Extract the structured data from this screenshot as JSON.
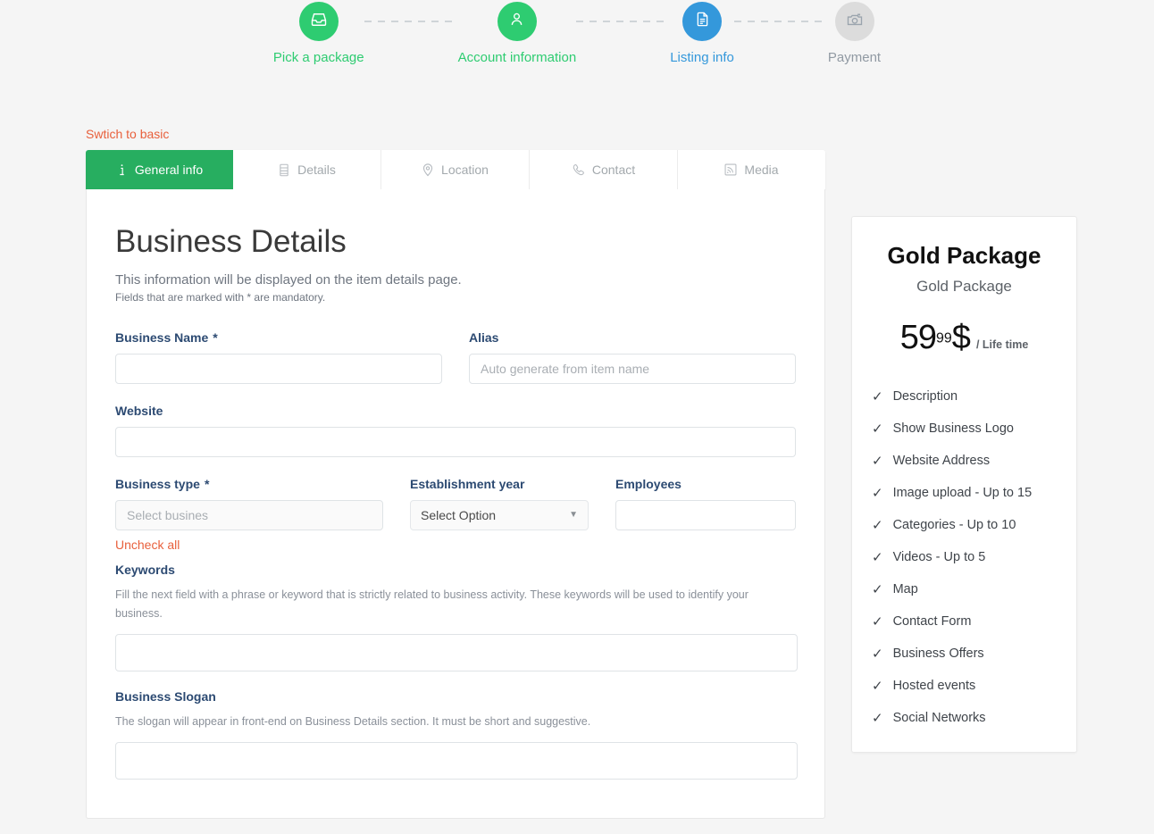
{
  "stepper": {
    "steps": [
      {
        "label": "Pick a package",
        "icon": "inbox-icon",
        "state": "green"
      },
      {
        "label": "Account information",
        "icon": "user-icon",
        "state": "green"
      },
      {
        "label": "Listing info",
        "icon": "document-icon",
        "state": "blue"
      },
      {
        "label": "Payment",
        "icon": "camera-icon",
        "state": "gray"
      }
    ]
  },
  "switch_link": "Swtich to basic",
  "tabs": [
    {
      "label": "General info",
      "icon": "info-icon",
      "active": true
    },
    {
      "label": "Details",
      "icon": "list-icon",
      "active": false
    },
    {
      "label": "Location",
      "icon": "map-pin-icon",
      "active": false
    },
    {
      "label": "Contact",
      "icon": "phone-icon",
      "active": false
    },
    {
      "label": "Media",
      "icon": "rss-icon",
      "active": false
    }
  ],
  "form": {
    "title": "Business Details",
    "subtitle": "This information will be displayed on the item details page.",
    "note": "Fields that are marked with * are mandatory.",
    "business_name": {
      "label": "Business Name",
      "required": "*",
      "value": "",
      "placeholder": ""
    },
    "alias": {
      "label": "Alias",
      "value": "",
      "placeholder": "Auto generate from item name"
    },
    "website": {
      "label": "Website",
      "value": "",
      "placeholder": ""
    },
    "business_type": {
      "label": "Business type",
      "required": "*",
      "value": "",
      "placeholder": "Select busines",
      "uncheck_label": "Uncheck all"
    },
    "establishment_year": {
      "label": "Establishment year",
      "selected": "Select Option",
      "caret": "▼"
    },
    "employees": {
      "label": "Employees",
      "value": "",
      "placeholder": ""
    },
    "keywords": {
      "label": "Keywords",
      "help": "Fill the next field with a phrase or keyword that is strictly related to business activity. These keywords will be used to identify your business.",
      "value": "",
      "placeholder": ""
    },
    "slogan": {
      "label": "Business Slogan",
      "help": "The slogan will appear in front-end on Business Details section. It must be short and suggestive.",
      "value": "",
      "placeholder": ""
    }
  },
  "package": {
    "title": "Gold Package",
    "subtitle": "Gold Package",
    "price_main": "59",
    "price_cents": "99",
    "currency": "$",
    "period": "/ Life time",
    "check_glyph": "✓",
    "features": [
      "Description",
      "Show Business Logo",
      "Website Address",
      "Image upload - Up to 15",
      "Categories - Up to 10",
      "Videos - Up to 5",
      "Map",
      "Contact Form",
      "Business Offers",
      "Hosted events",
      "Social Networks"
    ]
  },
  "colors": {
    "green": "#2ecc71",
    "tab_green": "#27ae60",
    "blue": "#3498db",
    "gray": "#dcdcdc",
    "orange_link": "#e8603c",
    "label_navy": "#2c4a72",
    "page_bg": "#f5f5f5"
  }
}
